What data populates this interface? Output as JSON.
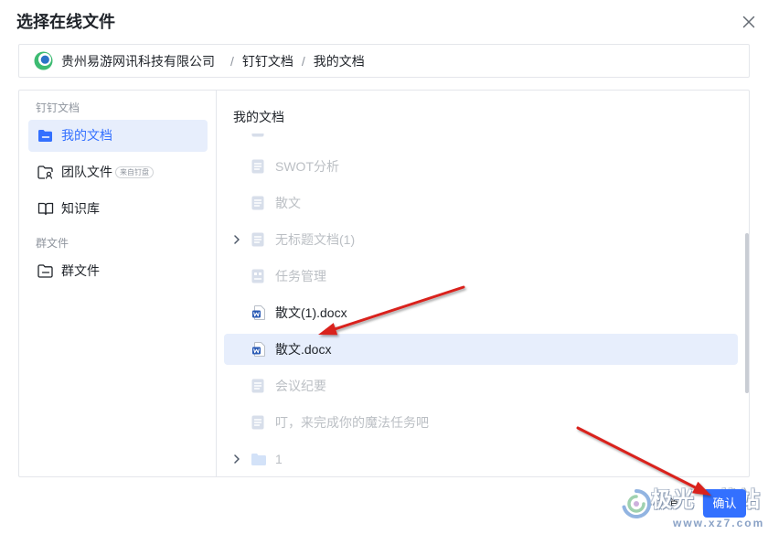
{
  "dialog": {
    "title": "选择在线文件",
    "close_icon": "close-icon"
  },
  "breadcrumb": {
    "org_logo_icon": "org-logo-icon",
    "org": "贵州易游网讯科技有限公司",
    "separator": "/",
    "path": [
      "钉钉文档",
      "我的文档"
    ]
  },
  "sidebar": {
    "sections": [
      {
        "label": "钉钉文档",
        "items": [
          {
            "label": "我的文档",
            "icon": "folder-filled-icon",
            "selected": true
          },
          {
            "label": "团队文件",
            "icon": "team-folder-icon",
            "badge": "来自钉盘"
          },
          {
            "label": "知识库",
            "icon": "book-icon"
          }
        ]
      },
      {
        "label": "群文件",
        "items": [
          {
            "label": "群文件",
            "icon": "folder-icon"
          }
        ]
      }
    ]
  },
  "main": {
    "heading": "我的文档",
    "files": [
      {
        "label": "",
        "icon": "doc-icon",
        "disabled": true
      },
      {
        "label": "SWOT分析",
        "icon": "doc-icon",
        "disabled": true
      },
      {
        "label": "散文",
        "icon": "doc-icon",
        "disabled": true
      },
      {
        "label": "无标题文档(1)",
        "icon": "doc-icon",
        "disabled": true,
        "expandable": true
      },
      {
        "label": "任务管理",
        "icon": "table-icon",
        "disabled": true
      },
      {
        "label": "散文(1).docx",
        "icon": "word-icon",
        "disabled": false
      },
      {
        "label": "散文.docx",
        "icon": "word-icon",
        "disabled": false,
        "selected": true
      },
      {
        "label": "会议纪要",
        "icon": "doc-icon",
        "disabled": true
      },
      {
        "label": "叮，来完成你的魔法任务吧",
        "icon": "doc-icon",
        "disabled": true
      },
      {
        "label": "1",
        "icon": "folder-icon",
        "disabled": true,
        "expandable": true
      }
    ]
  },
  "footer": {
    "cancel_label": "取消",
    "confirm_label": "确认"
  },
  "watermark": {
    "logo_icon": "watermark-logo-icon",
    "name": "极光下载站",
    "url": "www.xz7.com"
  },
  "colors": {
    "accent": "#3370ff",
    "selected_bg": "#e7eefc",
    "muted_text": "#bbbfc4",
    "border": "#e4e6eb",
    "annotation_arrow": "#d9201f"
  }
}
